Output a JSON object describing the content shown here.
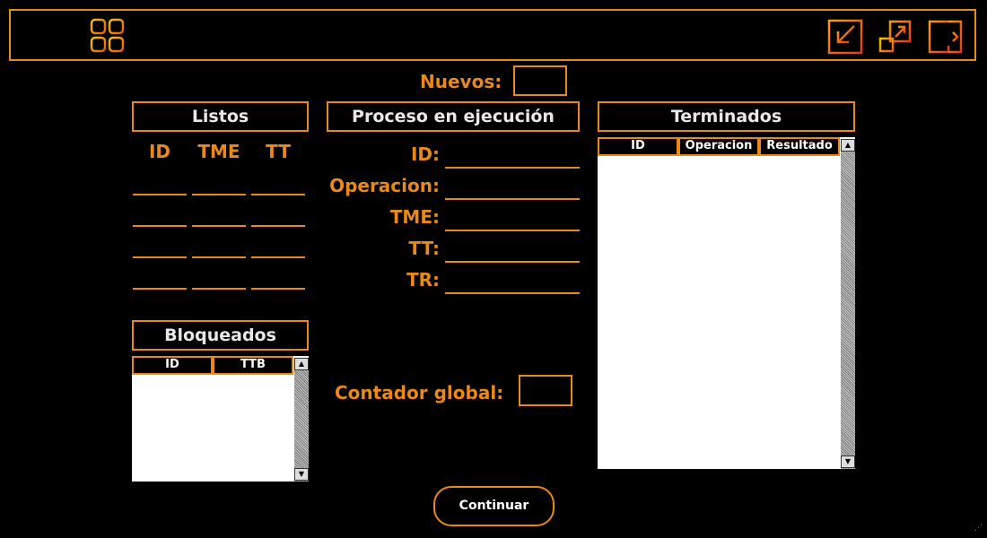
{
  "colors": {
    "accent": "#e8891a",
    "background": "#000000"
  },
  "toolbar": {
    "icons": [
      "grid-icon",
      "minimize-icon",
      "maximize-icon",
      "exit-icon"
    ]
  },
  "nuevos": {
    "label": "Nuevos:",
    "value": ""
  },
  "listos": {
    "title": "Listos",
    "columns": [
      "ID",
      "TME",
      "TT"
    ]
  },
  "bloqueados": {
    "title": "Bloqueados",
    "columns": [
      "ID",
      "TTB"
    ]
  },
  "ejecucion": {
    "title": "Proceso en ejecución",
    "fields": [
      "ID:",
      "Operacion:",
      "TME:",
      "TT:",
      "TR:"
    ]
  },
  "contador": {
    "label": "Contador global:",
    "value": ""
  },
  "terminados": {
    "title": "Terminados",
    "columns": [
      "ID",
      "Operacion",
      "Resultado"
    ]
  },
  "continuar_label": "Continuar"
}
